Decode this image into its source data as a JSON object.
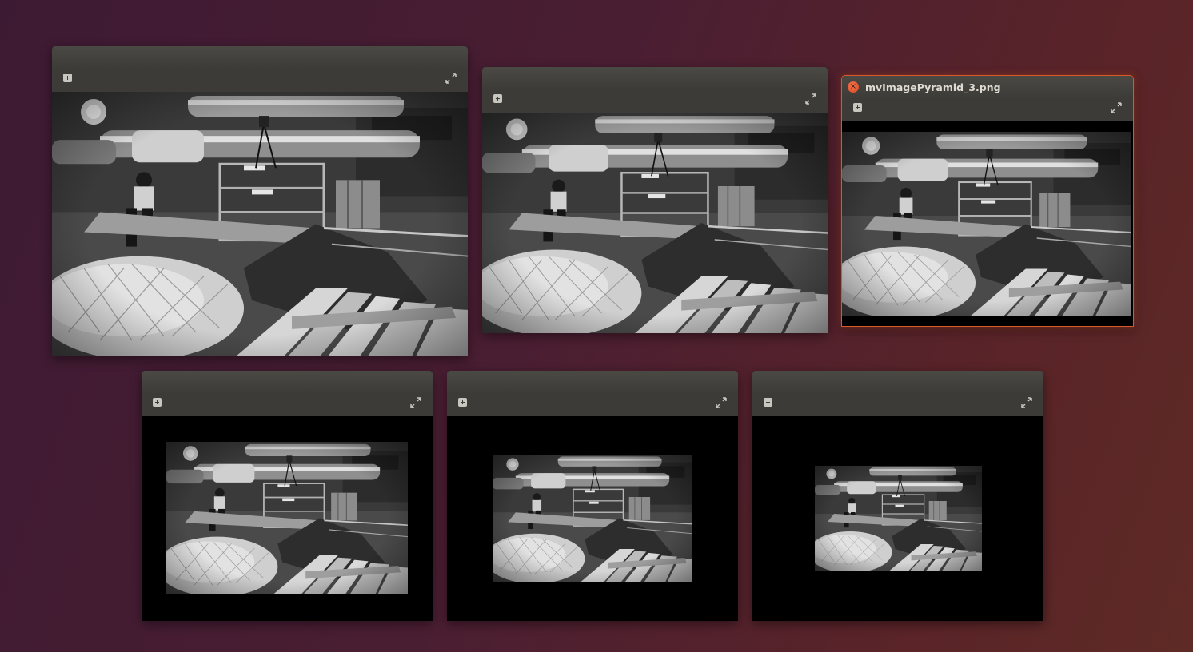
{
  "windows": [
    {
      "id": "w0",
      "title": "",
      "active": false
    },
    {
      "id": "w1",
      "title": "",
      "active": false
    },
    {
      "id": "w2",
      "title": "mvImagePyramid_3.png",
      "active": true
    },
    {
      "id": "w3",
      "title": "",
      "active": false
    },
    {
      "id": "w4",
      "title": "",
      "active": false
    },
    {
      "id": "w5",
      "title": "",
      "active": false
    }
  ],
  "icons": {
    "close": "close-icon",
    "toolbar_left": "pan-icon",
    "toolbar_right": "expand-icon"
  },
  "colors": {
    "accent": "#d9582a",
    "titlebar": "#3c3b37",
    "title_text": "#dfdbd2"
  },
  "close_glyph": "×"
}
